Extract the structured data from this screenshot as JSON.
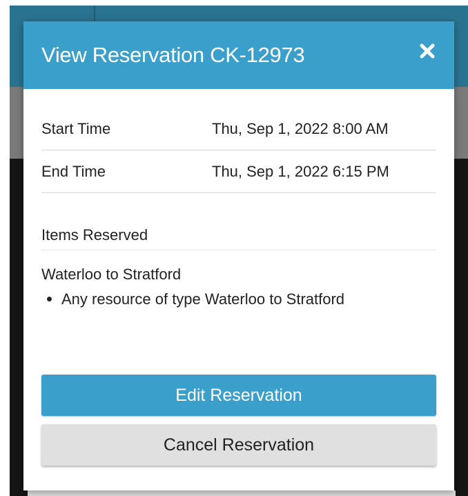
{
  "modal": {
    "title": "View Reservation CK-12973",
    "close_icon": "close-icon",
    "details": [
      {
        "label": "Start Time",
        "value": "Thu, Sep 1, 2022 8:00 AM"
      },
      {
        "label": "End Time",
        "value": "Thu, Sep 1, 2022 6:15 PM"
      }
    ],
    "items_heading": "Items Reserved",
    "items": [
      {
        "group": "Waterloo to Stratford",
        "entries": [
          "Any resource of type Waterloo to Stratford"
        ]
      }
    ],
    "buttons": {
      "edit_label": "Edit Reservation",
      "cancel_label": "Cancel Reservation"
    }
  },
  "colors": {
    "header": "#3b9fcb",
    "primary_button": "#3b9fcb",
    "secondary_button": "#e0e0e0",
    "backdrop_top": "#2a7390",
    "backdrop_dark": "#151515"
  }
}
